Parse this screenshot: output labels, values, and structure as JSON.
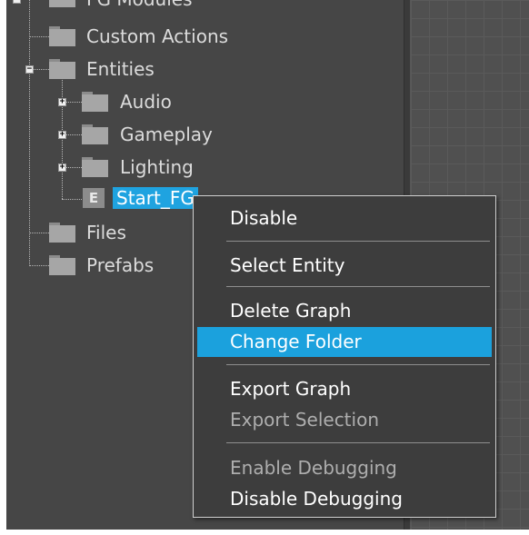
{
  "tree": {
    "top_partial_label": "FG Modules",
    "nodes": [
      {
        "label": "Custom Actions"
      },
      {
        "label": "Entities"
      },
      {
        "label": "Audio"
      },
      {
        "label": "Gameplay"
      },
      {
        "label": "Lighting"
      },
      {
        "label": "Start_FG",
        "icon_letter": "E"
      },
      {
        "label": "Files"
      },
      {
        "label": "Prefabs"
      }
    ],
    "expander_plus": "+",
    "expander_minus": "−"
  },
  "context_menu": {
    "items": [
      {
        "label": "Disable",
        "enabled": true
      },
      {
        "label": "Select Entity",
        "enabled": true
      },
      {
        "label": "Delete Graph",
        "enabled": true
      },
      {
        "label": "Change Folder",
        "enabled": true,
        "highlighted": true
      },
      {
        "label": "Export Graph",
        "enabled": true
      },
      {
        "label": "Export Selection",
        "enabled": false
      },
      {
        "label": "Enable Debugging",
        "enabled": false
      },
      {
        "label": "Disable Debugging",
        "enabled": true
      }
    ]
  },
  "colors": {
    "selection": "#1fa3e0",
    "menu_highlight": "#1ba1dd",
    "pane_background": "#464646"
  }
}
